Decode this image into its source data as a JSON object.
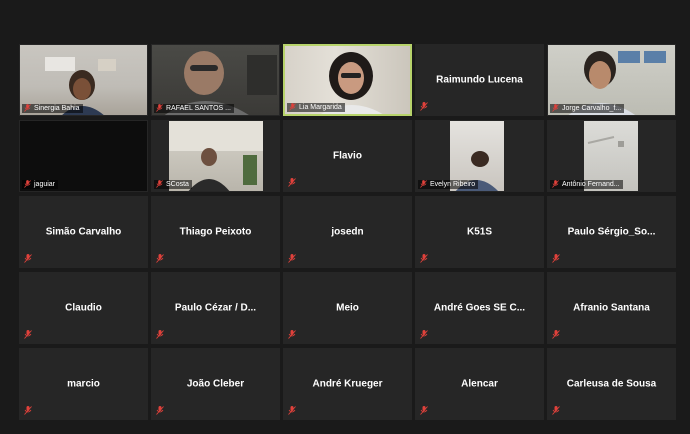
{
  "colors": {
    "background": "#1a1a1a",
    "tile": "#262626",
    "active_speaker": "#b7d36b",
    "mute_icon": "#e0413b"
  },
  "participants": [
    {
      "name": "Sinergia Bahia",
      "has_video": true,
      "muted": true
    },
    {
      "name": "RAFAEL SANTOS ...",
      "has_video": true,
      "muted": true
    },
    {
      "name": "Lia Margarida",
      "has_video": true,
      "muted": true,
      "speaking": true
    },
    {
      "name": "Raimundo Lucena",
      "has_video": false,
      "muted": true
    },
    {
      "name": "Jorge Carvalho_f...",
      "has_video": true,
      "muted": true
    },
    {
      "name": "jaguiar",
      "has_video": true,
      "muted": true
    },
    {
      "name": "SCosta",
      "has_video": true,
      "muted": true
    },
    {
      "name": "Flavio",
      "has_video": false,
      "muted": true
    },
    {
      "name": "Evelyn Ribeiro",
      "has_video": true,
      "muted": true
    },
    {
      "name": "Antônio Fernand...",
      "has_video": true,
      "muted": true
    },
    {
      "name": "Simão Carvalho",
      "has_video": false,
      "muted": true
    },
    {
      "name": "Thiago Peixoto",
      "has_video": false,
      "muted": true
    },
    {
      "name": "josedn",
      "has_video": false,
      "muted": true
    },
    {
      "name": "K51S",
      "has_video": false,
      "muted": true
    },
    {
      "name": "Paulo  Sérgio_So...",
      "has_video": false,
      "muted": true
    },
    {
      "name": "Claudio",
      "has_video": false,
      "muted": true
    },
    {
      "name": "Paulo Cézar / D...",
      "has_video": false,
      "muted": true
    },
    {
      "name": "Meio",
      "has_video": false,
      "muted": true
    },
    {
      "name": "André Goes SE C...",
      "has_video": false,
      "muted": true
    },
    {
      "name": "Afranio Santana",
      "has_video": false,
      "muted": true
    },
    {
      "name": "marcio",
      "has_video": false,
      "muted": true
    },
    {
      "name": "João Cleber",
      "has_video": false,
      "muted": true
    },
    {
      "name": "André Krueger",
      "has_video": false,
      "muted": true
    },
    {
      "name": "Alencar",
      "has_video": false,
      "muted": true
    },
    {
      "name": "Carleusa de Sousa",
      "has_video": false,
      "muted": true
    }
  ]
}
